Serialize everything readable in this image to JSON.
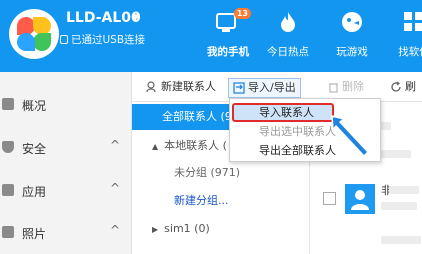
{
  "device": {
    "name": "LLD-AL00",
    "status": "已通过USB连接"
  },
  "nav": [
    {
      "label": "我的手机",
      "badge": "13",
      "active": true
    },
    {
      "label": "今日热点"
    },
    {
      "label": "玩游戏"
    },
    {
      "label": "找软件"
    }
  ],
  "sidebar": {
    "items": [
      {
        "label": "概况"
      },
      {
        "label": "安全"
      },
      {
        "label": "应用"
      },
      {
        "label": "照片"
      }
    ],
    "chevron": "^"
  },
  "toolbar": {
    "new_contact": "新建联系人",
    "import_export": "导入/导出",
    "delete": "删除",
    "refresh": "刷"
  },
  "groups": {
    "all": "全部联系人 (9",
    "local": "本地联系人 (",
    "ungrouped": "未分组 (971)",
    "new_group": "新建分组...",
    "sim": "sim1 (0)"
  },
  "dropdown": {
    "items": [
      {
        "label": "导入联系人"
      },
      {
        "label": "导出选中联系人"
      },
      {
        "label": "导出全部联系人"
      }
    ]
  },
  "contacts": {
    "name_fragment": "非"
  },
  "colors": {
    "header": "#1296f0",
    "highlight_border": "#e12b2b",
    "badge": "#ff7a2f"
  }
}
